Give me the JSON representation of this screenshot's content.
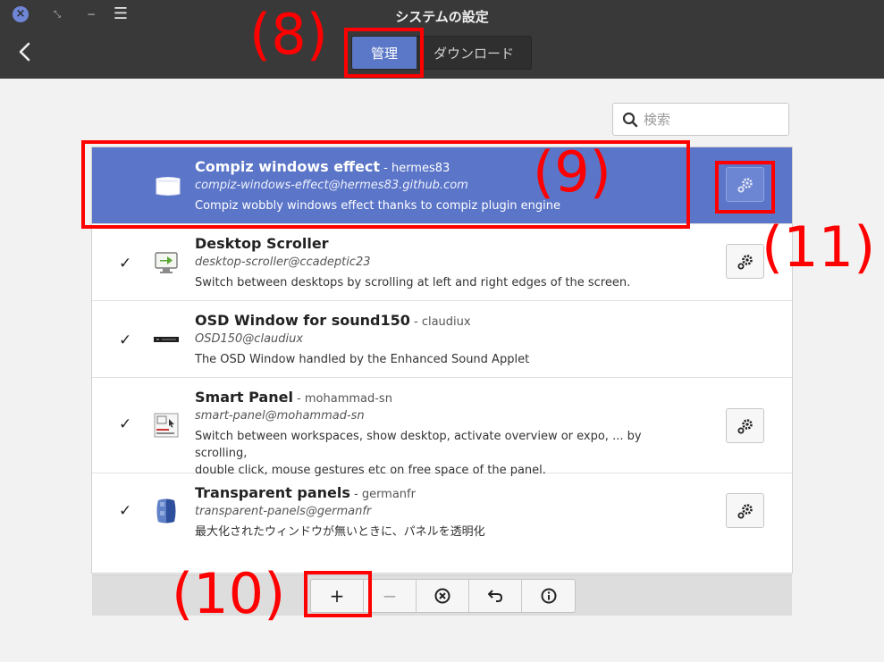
{
  "window": {
    "title": "システムの設定",
    "close_symbol": "×",
    "restore_symbol": "⤡",
    "minimize_symbol": "−",
    "menu_symbol": "☰"
  },
  "switcher": {
    "manage_label": "管理",
    "download_label": "ダウンロード"
  },
  "search": {
    "placeholder": "検索",
    "value": ""
  },
  "extensions": [
    {
      "name": "Compiz windows effect",
      "author": " - hermes83",
      "uuid": "compiz-windows-effect@hermes83.github.com",
      "description": "Compiz wobbly windows effect thanks to compiz plugin engine",
      "enabled": false,
      "selected": true,
      "has_config": true,
      "icon": "window-icon"
    },
    {
      "name": "Desktop Scroller",
      "author": "",
      "uuid": "desktop-scroller@ccadeptic23",
      "description": "Switch between desktops by scrolling at left and right edges of the screen.",
      "enabled": true,
      "selected": false,
      "has_config": true,
      "icon": "desktop-arrow-icon"
    },
    {
      "name": "OSD Window for sound150",
      "author": " - claudiux",
      "uuid": "OSD150@claudiux",
      "description": "The OSD Window handled by the Enhanced Sound Applet",
      "enabled": true,
      "selected": false,
      "has_config": false,
      "icon": "osd-bar-icon"
    },
    {
      "name": "Smart Panel",
      "author": " - mohammad-sn",
      "uuid": "smart-panel@mohammad-sn",
      "description": "Switch between workspaces, show desktop, activate overview or expo, ... by scrolling,",
      "description2": "double click, mouse gestures etc on free space of the panel.",
      "enabled": true,
      "selected": false,
      "has_config": true,
      "icon": "smart-panel-icon"
    },
    {
      "name": "Transparent panels",
      "author": " - germanfr",
      "uuid": "transparent-panels@germanfr",
      "description": "最大化されたウィンドウが無いときに、パネルを透明化",
      "enabled": true,
      "selected": false,
      "has_config": true,
      "icon": "transparent-panels-icon"
    }
  ],
  "toolbar": {
    "add_label": "+",
    "remove_label": "−"
  },
  "annotations": {
    "a8": "(8)",
    "a9": "(9)",
    "a10": "(10)",
    "a11": "(11)"
  },
  "colors": {
    "accent": "#5b75c8",
    "annotation": "#ff0000",
    "header": "#393939"
  }
}
